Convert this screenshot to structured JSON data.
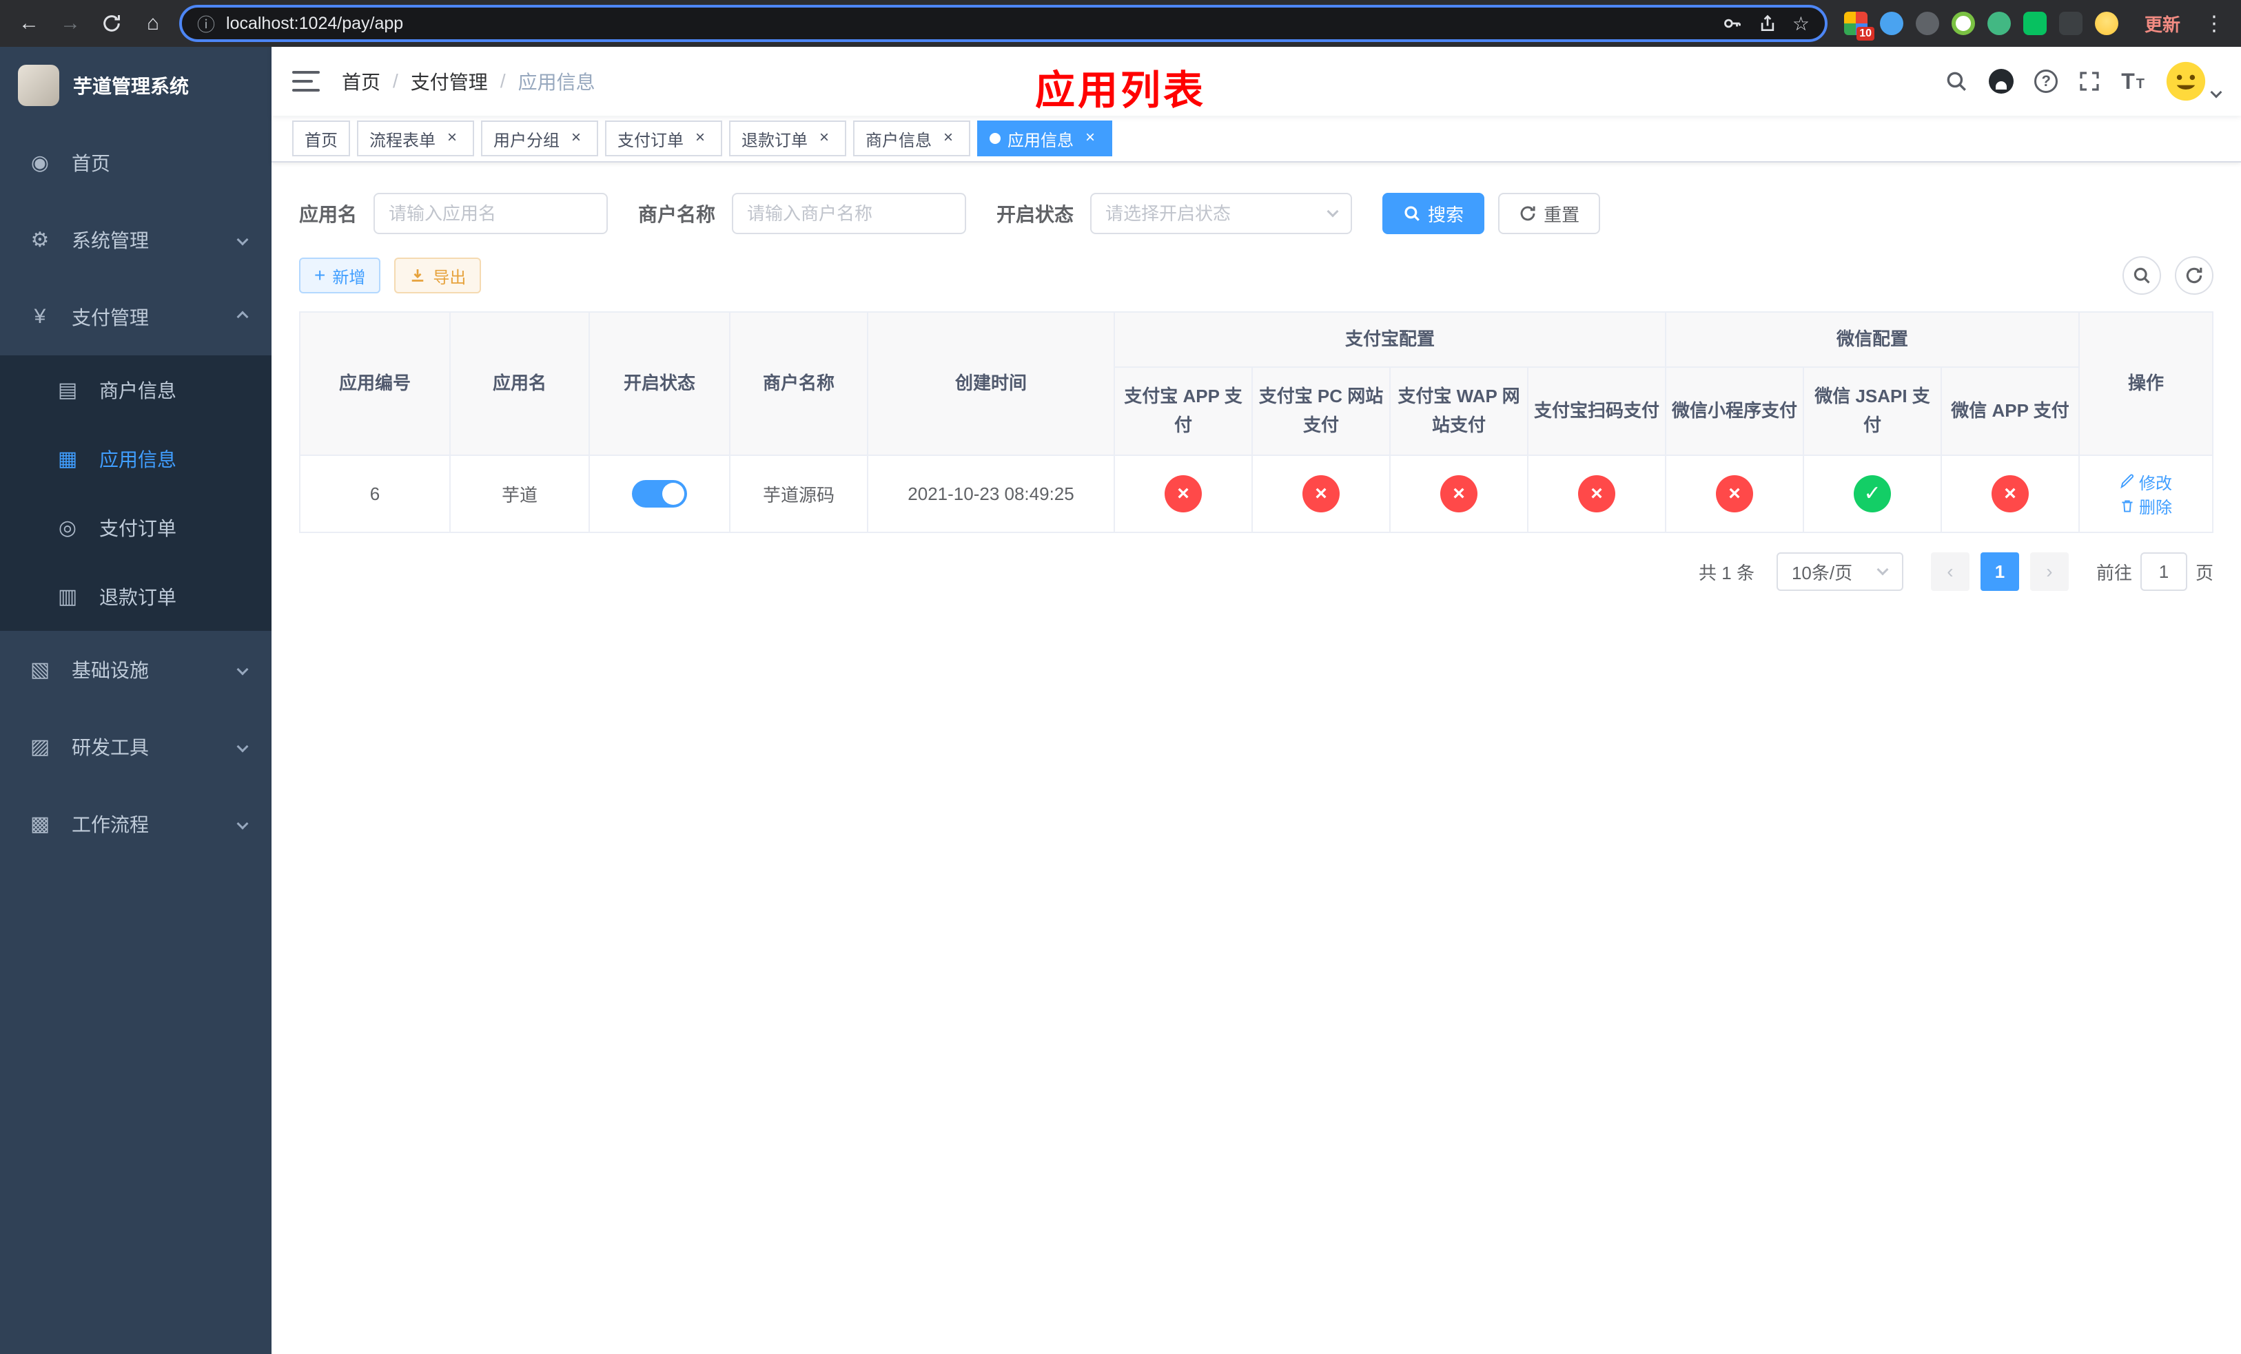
{
  "browser": {
    "url": "localhost:1024/pay/app",
    "update_button": "更新",
    "extension_badge": "10"
  },
  "icons": {
    "back_arrow": "←",
    "forward_arrow": "→",
    "home_browser": "⌂",
    "info_circled": "ⓘ",
    "star": "☆",
    "kebab": "⋮",
    "plus": "+",
    "help": "?",
    "font_size_big": "T",
    "font_size_small": "T",
    "close": "×",
    "prev": "‹",
    "next": "›",
    "dashboard": "◉",
    "gear": "⚙",
    "yen": "¥",
    "merchant_card": "▤",
    "app_grid": "▦",
    "pay_order": "◎",
    "refund_doc": "▥",
    "infra": "▧",
    "devtools": "▨",
    "workflow": "▩"
  },
  "glyphs": {
    "true": "✓",
    "false": "×"
  },
  "sidebar": {
    "app_title": "芋道管理系统",
    "menu": {
      "home": "首页",
      "system": "系统管理",
      "payment": "支付管理",
      "infra": "基础设施",
      "devtools": "研发工具",
      "workflow": "工作流程"
    },
    "payment_children": {
      "merchant": "商户信息",
      "app": "应用信息",
      "order": "支付订单",
      "refund": "退款订单"
    }
  },
  "navbar": {
    "breadcrumb": [
      "首页",
      "支付管理",
      "应用信息"
    ],
    "separator": "/",
    "annotation": "应用列表"
  },
  "tabs": [
    {
      "label": "首页",
      "closable": false,
      "active": false
    },
    {
      "label": "流程表单",
      "closable": true,
      "active": false
    },
    {
      "label": "用户分组",
      "closable": true,
      "active": false
    },
    {
      "label": "支付订单",
      "closable": true,
      "active": false
    },
    {
      "label": "退款订单",
      "closable": true,
      "active": false
    },
    {
      "label": "商户信息",
      "closable": true,
      "active": false
    },
    {
      "label": "应用信息",
      "closable": true,
      "active": true
    }
  ],
  "filters": {
    "app_name": {
      "label": "应用名",
      "placeholder": "请输入应用名",
      "value": ""
    },
    "merchant_name": {
      "label": "商户名称",
      "placeholder": "请输入商户名称",
      "value": ""
    },
    "status": {
      "label": "开启状态",
      "placeholder": "请选择开启状态",
      "value": ""
    },
    "search": "搜索",
    "reset": "重置"
  },
  "toolbar": {
    "add": "新增",
    "export": "导出"
  },
  "table": {
    "columns": {
      "app_id": "应用编号",
      "app_name": "应用名",
      "status": "开启状态",
      "merchant": "商户名称",
      "created": "创建时间",
      "actions": "操作",
      "alipay_group": "支付宝配置",
      "wechat_group": "微信配置",
      "pay_channels": [
        "支付宝 APP 支付",
        "支付宝 PC 网站支付",
        "支付宝 WAP 网站支付",
        "支付宝扫码支付",
        "微信小程序支付",
        "微信 JSAPI 支付",
        "微信 APP 支付"
      ]
    },
    "row": {
      "id": "6",
      "name": "芋道",
      "enabled": true,
      "merchant": "芋道源码",
      "created": "2021-10-23 08:49:25",
      "channel_status": [
        false,
        false,
        false,
        false,
        false,
        true,
        false
      ],
      "edit": "修改",
      "delete": "删除"
    }
  },
  "pagination": {
    "total": "共 1 条",
    "page_size": "10条/页",
    "page": "1",
    "goto": "前往",
    "goto_value": "1",
    "unit": "页"
  },
  "colors": {
    "primary": "#409eff",
    "success": "#13ce66",
    "danger": "#ff4949",
    "warning": "#e6a23c",
    "sidebar_bg": "#304156",
    "submenu_bg": "#1f2d3d",
    "annotation_red": "#ff0000"
  }
}
